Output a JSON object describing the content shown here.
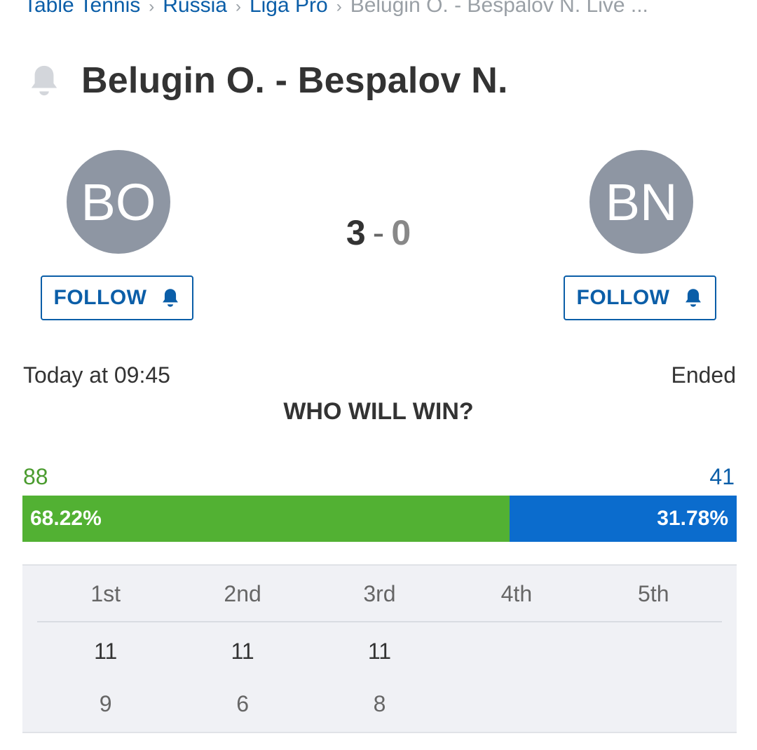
{
  "breadcrumb": {
    "items": [
      "Table Tennis",
      "Russia",
      "Liga Pro"
    ],
    "current": "Belugin O. - Bespalov N. Live ...",
    "separator": "›"
  },
  "match": {
    "title": "Belugin O. - Bespalov N.",
    "home": {
      "initials": "BO",
      "score": "3",
      "votes": "88",
      "vote_pct": "68.22%"
    },
    "away": {
      "initials": "BN",
      "score": "0",
      "votes": "41",
      "vote_pct": "31.78%"
    },
    "score_separator": "-",
    "start_time": "Today at 09:45",
    "status": "Ended"
  },
  "follow": {
    "label": "FOLLOW"
  },
  "poll": {
    "heading": "WHO WILL WIN?",
    "home_fraction": 0.6822
  },
  "sets": {
    "headers": [
      "1st",
      "2nd",
      "3rd",
      "4th",
      "5th"
    ],
    "home": [
      "11",
      "11",
      "11",
      "",
      ""
    ],
    "away": [
      "9",
      "6",
      "8",
      "",
      ""
    ]
  },
  "colors": {
    "link": "#0b5ea8",
    "home_vote": "#52b133",
    "away_vote": "#0b6ccd",
    "avatar_bg": "#8e96a3"
  },
  "icons": {
    "title": "bell-icon",
    "follow": "bell-icon"
  }
}
